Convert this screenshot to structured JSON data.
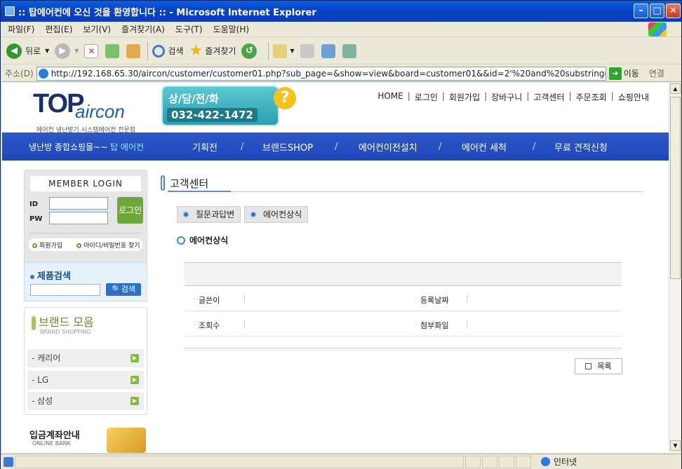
{
  "window": {
    "title": ":: 탑에어컨에 오신 것을 환영합니다 :: - Microsoft Internet Explorer"
  },
  "menu": [
    "파일(F)",
    "편집(E)",
    "보기(V)",
    "즐겨찾기(A)",
    "도구(T)",
    "도움말(H)"
  ],
  "toolbar": {
    "back": "뒤로",
    "search": "검색",
    "favorites": "즐겨찾기"
  },
  "address": {
    "label": "주소(D)",
    "url": "http://192.168.65.30/aircon/customer/customer01.php?sub_page=&show=view&board=customer01&&id=2'%20and%20substring((select%2(",
    "go": "이동",
    "links": "연결"
  },
  "status": {
    "zone": "인터넷"
  },
  "site": {
    "logo": {
      "big": "TOP",
      "air": "aircon",
      "tagline": "에어컨 냉난방기 시스템에어컨 전문점"
    },
    "phone": {
      "label": "상/담/전/화",
      "number": "032-422-1472"
    },
    "topnav": [
      "HOME",
      "로그인",
      "회원가입",
      "장바구니",
      "고객센터",
      "주문조회",
      "쇼핑안내"
    ],
    "promo_prefix": "냉난방 종합쇼핑몰~~ ",
    "promo_brand": "탑 에어컨",
    "gnb": [
      "기획전",
      "브랜드SHOP",
      "에어컨이전설치",
      "에어컨 세척",
      "무료 견적신청"
    ]
  },
  "login": {
    "header": "MEMBER LOGIN",
    "id_label": "ID",
    "pw_label": "PW",
    "button": "로그인",
    "join": "회원가입",
    "find": "아이디/비밀번호 찾기"
  },
  "search": {
    "title": "제품검색",
    "button": "검색"
  },
  "brand": {
    "title": "브랜드 모음",
    "subtitle": "BRAND SHOPPING",
    "items": [
      "- 캐리어",
      "- LG",
      "- 삼성"
    ]
  },
  "bank": {
    "title": "입금계좌안내",
    "subtitle": "ONLINE BANK"
  },
  "main": {
    "title": "고객센터",
    "tabs": [
      "질문과답변",
      "에어컨상식"
    ],
    "subtitle": "에어컨상식",
    "fields": {
      "writer": "글쓴이",
      "date": "등록날짜",
      "views": "조회수",
      "attach": "첨부화일"
    },
    "list_button": "목록"
  }
}
